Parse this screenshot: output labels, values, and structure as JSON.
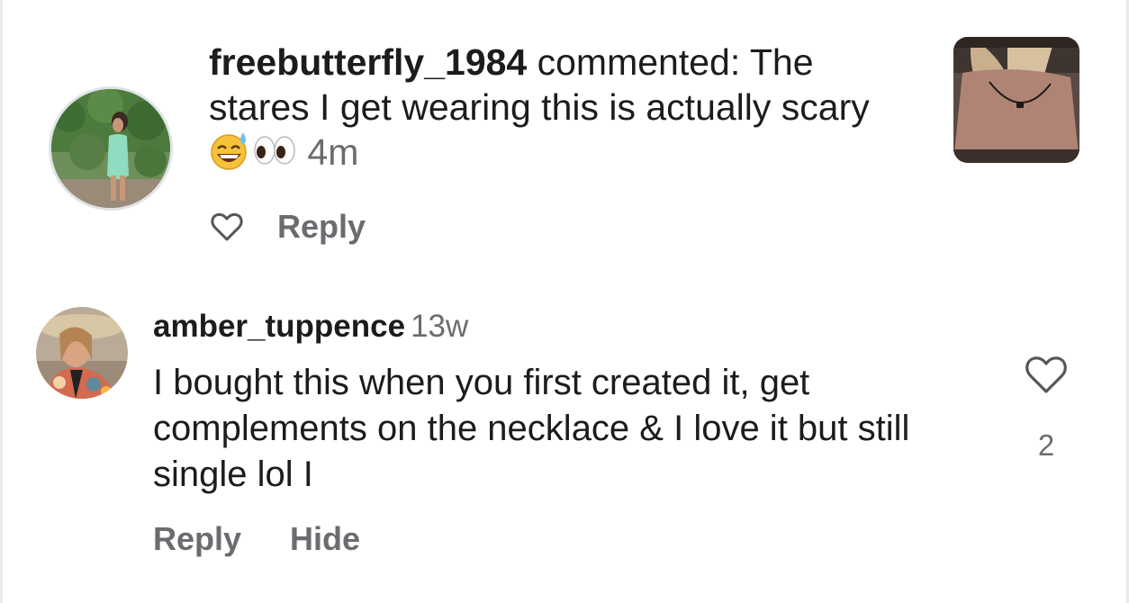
{
  "notification": {
    "username": "freebutterfly_1984",
    "text_before": " commented: The stares I get wearing this is actually scary ",
    "emojis": [
      "😅",
      "👀"
    ],
    "time": "4m",
    "reply_label": "Reply",
    "icons": {
      "like": "heart-outline-icon"
    }
  },
  "comment": {
    "username": "amber_tuppence",
    "time": "13w",
    "body": "I bought this when you first created it, get complements on the necklace & I love it but still single lol I",
    "like_count": "2",
    "reply_label": "Reply",
    "hide_label": "Hide",
    "icons": {
      "like": "heart-outline-icon"
    }
  },
  "colors": {
    "text": "#1c1c1e",
    "secondary_text": "#6b6b70",
    "background": "#ffffff"
  }
}
